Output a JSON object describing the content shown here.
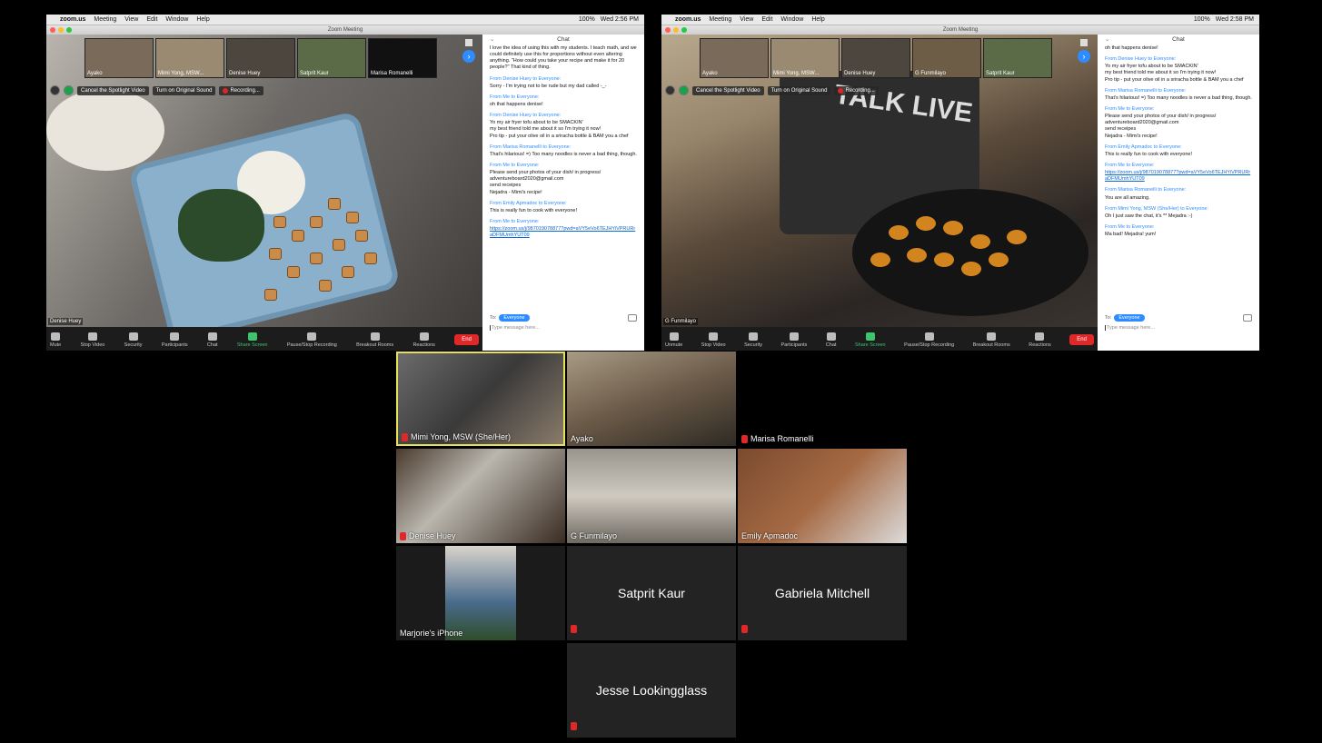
{
  "menubar": {
    "apple": "",
    "app": "zoom.us",
    "items": [
      "Meeting",
      "View",
      "Edit",
      "Window",
      "Help"
    ],
    "battery": "100%",
    "time_left": "Wed 2:56 PM",
    "time_right": "Wed 2:58 PM"
  },
  "window_title": "Zoom Meeting",
  "left_window": {
    "thumbnails": [
      "Ayako",
      "Mimi Yong, MSW...",
      "Denise Huey",
      "Satprit Kaur",
      "Marisa Romanelli"
    ],
    "spotlight_bar": {
      "cancel": "Cancel the Spotlight Video",
      "original_sound": "Turn on Original Sound",
      "recording": "Recording..."
    },
    "speaker_name": "Denise Huey",
    "chat_title": "Chat",
    "messages": [
      {
        "from": "",
        "text": "I love the idea of using this with my students.  I teach math, and we could definitely use this for proportions without even altering anything.  \"How could you take your recipe and make it for 20 people?\"  That kind of thing."
      },
      {
        "from": "From Denise Huey to Everyone:",
        "text": "Sorry - I'm trying not to be rude but my dad called -_-"
      },
      {
        "from": "From Me to Everyone:",
        "text": "oh that happens denise!"
      },
      {
        "from": "From Denise Huey to Everyone:",
        "text": "Yo my air fryer tofu about to be SMACKIN'\nmy best friend told me about it so I'm trying it now!\nPro tip - put your olive oil in a sriracha bottle & BAM you a chef"
      },
      {
        "from": "From Marisa Romanelli to Everyone:",
        "text": "That's hilarious!  =)  Too many noodles is never a bad thing, though."
      },
      {
        "from": "From Me to Everyone:",
        "text": "Please send your photos of your dish/ in progress/\nadventureboard2020@gmail.com\nsend receipes\nNejadra - Mimi's recipe!"
      },
      {
        "from": "From Emily Apmadoc to Everyone:",
        "text": "This is really fun to cook with everyone!"
      },
      {
        "from": "From Me to Everyone:",
        "link": "https://zoom.us/j/987019078877?pwd=aVY5eVo6TEJHYiVPRURraDFMUmhYUT09"
      }
    ],
    "to_label": "To:",
    "to_value": "Everyone",
    "input_placeholder": "Type message here..."
  },
  "right_window": {
    "thumbnails": [
      "Ayako",
      "Mimi Yong, MSW...",
      "Denise Huey",
      "G Funmilayo",
      "Satprit Kaur"
    ],
    "spotlight_bar": {
      "cancel": "Cancel the Spotlight Video",
      "original_sound": "Turn on Original Sound",
      "recording": "Recording..."
    },
    "speaker_name": "G Funmilayo",
    "shirt_text": "TALK LIVE",
    "chat_title": "Chat",
    "messages": [
      {
        "from": "",
        "text": "oh that happens denise!"
      },
      {
        "from": "From Denise Huey to Everyone:",
        "text": "Yo my air fryer tofu about to be SMACKIN'\nmy best friend told me about it so I'm trying it now!\nPro tip - put your olive oil in a sriracha bottle & BAM you a chef"
      },
      {
        "from": "From Marisa Romanelli to Everyone:",
        "text": "That's hilarious!  =)  Too many noodles is never a bad thing, though."
      },
      {
        "from": "From Me to Everyone:",
        "text": "Please send your photos of your dish/ in progress/\nadventureboard2020@gmail.com\nsend receipes\nNejadra - Mimi's recipe!"
      },
      {
        "from": "From Emily Apmadoc to Everyone:",
        "text": "This is really fun to cook with everyone!"
      },
      {
        "from": "From Me to Everyone:",
        "link": "https://zoom.us/j/987019078877?pwd=aVY5eVo6TEJHYiVPRURraDFMUmhYUT09"
      },
      {
        "from": "From Marisa Romanelli to Everyone:",
        "text": "You are all amazing."
      },
      {
        "from": "From Mimi Yong, MSW (She/Her) to Everyone:",
        "text": "Oh I just saw the chat, it's ** Mejadra :-)"
      },
      {
        "from": "From Me to Everyone:",
        "text": "Ma bad! Mejadra! yum!"
      }
    ],
    "to_label": "To:",
    "to_value": "Everyone",
    "input_placeholder": "Type message here..."
  },
  "toolbar_left": [
    "Mute",
    "Stop Video",
    "Security",
    "Participants",
    "Chat",
    "Share Screen",
    "Pause/Stop Recording",
    "Breakout Rooms",
    "Reactions"
  ],
  "toolbar_right": [
    "Unmute",
    "Stop Video",
    "Security",
    "Participants",
    "Chat",
    "Share Screen",
    "Pause/Stop Recording",
    "Breakout Rooms",
    "Reactions"
  ],
  "participants_count": "11",
  "end_label": "End",
  "gallery": [
    {
      "name": "Mimi Yong, MSW (She/Her)",
      "muted": true,
      "video": true
    },
    {
      "name": "Ayako",
      "muted": false,
      "video": true
    },
    {
      "name": "Marisa Romanelli",
      "muted": true,
      "video": false
    },
    {
      "name": "Denise Huey",
      "muted": true,
      "video": true
    },
    {
      "name": "G Funmilayo",
      "muted": false,
      "video": true
    },
    {
      "name": "Emily Apmadoc",
      "muted": false,
      "video": true
    },
    {
      "name": "Marjorie's iPhone",
      "muted": false,
      "video": true
    },
    {
      "name": "Satprit Kaur",
      "muted": true,
      "video": false
    },
    {
      "name": "Gabriela Mitchell",
      "muted": true,
      "video": false
    },
    {
      "name": "Jesse Lookingglass",
      "muted": true,
      "video": false
    }
  ],
  "colors": {
    "accent": "#2d8cff",
    "end": "#e02828",
    "share": "#3ec46d",
    "active_speaker": "#e4e05a"
  }
}
